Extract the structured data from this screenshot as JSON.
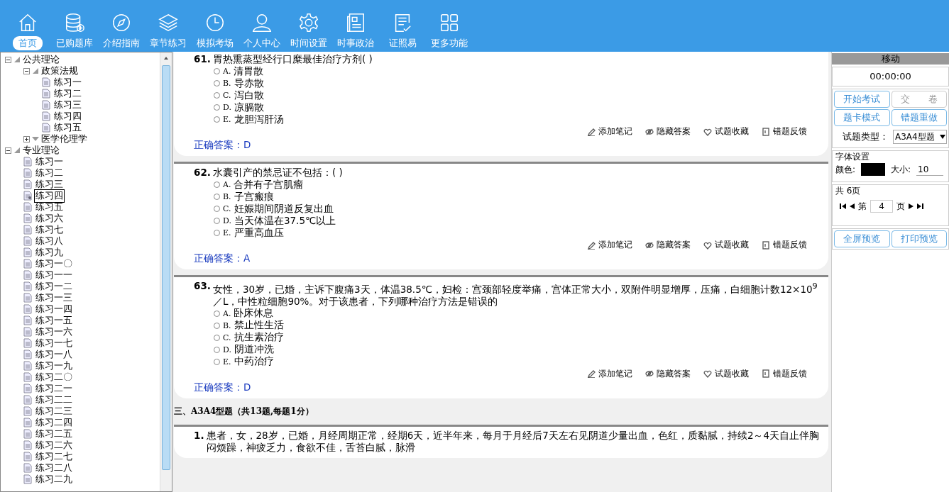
{
  "nav": [
    {
      "label": "首页",
      "selected": true
    },
    {
      "label": "已购题库",
      "selected": false
    },
    {
      "label": "介绍指南",
      "selected": false
    },
    {
      "label": "章节练习",
      "selected": false
    },
    {
      "label": "模拟考场",
      "selected": false
    },
    {
      "label": "个人中心",
      "selected": false
    },
    {
      "label": "时间设置",
      "selected": false
    },
    {
      "label": "时事政治",
      "selected": false
    },
    {
      "label": "证照易",
      "selected": false
    },
    {
      "label": "更多功能",
      "selected": false
    }
  ],
  "tree": [
    {
      "label": "公共理论",
      "expanded": true,
      "children": [
        {
          "label": "政策法规",
          "expanded": true,
          "children": [
            {
              "label": "练习一",
              "selected": false
            },
            {
              "label": "练习二",
              "selected": false
            },
            {
              "label": "练习三",
              "selected": false
            },
            {
              "label": "练习四",
              "selected": false
            },
            {
              "label": "练习五",
              "selected": false
            }
          ]
        },
        {
          "label": "医学伦理学",
          "expanded": false
        }
      ]
    },
    {
      "label": "专业理论",
      "expanded": true,
      "children": [
        {
          "label": "练习一",
          "selected": false
        },
        {
          "label": "练习二",
          "selected": false
        },
        {
          "label": "练习三",
          "selected": false
        },
        {
          "label": "练习四",
          "selected": true
        },
        {
          "label": "练习五",
          "selected": false
        },
        {
          "label": "练习六",
          "selected": false
        },
        {
          "label": "练习七",
          "selected": false
        },
        {
          "label": "练习八",
          "selected": false
        },
        {
          "label": "练习九",
          "selected": false
        },
        {
          "label": "练习一〇",
          "selected": false
        },
        {
          "label": "练习一一",
          "selected": false
        },
        {
          "label": "练习一二",
          "selected": false
        },
        {
          "label": "练习一三",
          "selected": false
        },
        {
          "label": "练习一四",
          "selected": false
        },
        {
          "label": "练习一五",
          "selected": false
        },
        {
          "label": "练习一六",
          "selected": false
        },
        {
          "label": "练习一七",
          "selected": false
        },
        {
          "label": "练习一八",
          "selected": false
        },
        {
          "label": "练习一九",
          "selected": false
        },
        {
          "label": "练习二〇",
          "selected": false
        },
        {
          "label": "练习二一",
          "selected": false
        },
        {
          "label": "练习二二",
          "selected": false
        },
        {
          "label": "练习二三",
          "selected": false
        },
        {
          "label": "练习二四",
          "selected": false
        },
        {
          "label": "练习二五",
          "selected": false
        },
        {
          "label": "练习二六",
          "selected": false
        },
        {
          "label": "练习二七",
          "selected": false
        },
        {
          "label": "练习二八",
          "selected": false
        },
        {
          "label": "练习二九",
          "selected": false
        }
      ]
    }
  ],
  "questions": [
    {
      "number": "61.",
      "text": "胃热熏蒸型经行口糜最佳治疗方剂( )",
      "options": [
        {
          "letter": "A.",
          "text": "清胃散",
          "selected": false
        },
        {
          "letter": "B.",
          "text": "导赤散",
          "selected": false
        },
        {
          "letter": "C.",
          "text": "泻白散",
          "selected": false
        },
        {
          "letter": "D.",
          "text": "凉膈散",
          "selected": false
        },
        {
          "letter": "E.",
          "text": "龙胆泻肝汤",
          "selected": false
        }
      ],
      "actions": [
        "添加笔记",
        "隐藏答案",
        "试题收藏",
        "错题反馈"
      ],
      "answer_label": "正确答案：",
      "answer": "D"
    },
    {
      "number": "62.",
      "text": "水囊引产的禁忌证不包括：( )",
      "options": [
        {
          "letter": "A.",
          "text": "合并有子宫肌瘤",
          "selected": false
        },
        {
          "letter": "B.",
          "text": "子宫瘢痕",
          "selected": false
        },
        {
          "letter": "C.",
          "text": "妊娠期间阴道反复出血",
          "selected": false
        },
        {
          "letter": "D.",
          "text": "当天体温在37.5℃以上",
          "selected": false
        },
        {
          "letter": "E.",
          "text": "严重高血压",
          "selected": false
        }
      ],
      "actions": [
        "添加笔记",
        "隐藏答案",
        "试题收藏",
        "错题反馈"
      ],
      "answer_label": "正确答案：",
      "answer": "A"
    },
    {
      "number": "63.",
      "text": "女性，30岁，已婚，主诉下腹痛3天，体温38.5℃，妇检：宫颈部轻度举痛，宫体正常大小，双附件明显增厚，压痛，白细胞计数12×10$^{9}$／L，中性粒细胞90%。对于该患者，下列哪种治疗方法是错误的",
      "options": [
        {
          "letter": "A.",
          "text": "卧床休息",
          "selected": false
        },
        {
          "letter": "B.",
          "text": "禁止性生活",
          "selected": false
        },
        {
          "letter": "C.",
          "text": "抗生素治疗",
          "selected": false
        },
        {
          "letter": "D.",
          "text": "阴道冲洗",
          "selected": false
        },
        {
          "letter": "E.",
          "text": "中药治疗",
          "selected": false
        }
      ],
      "actions": [
        "添加笔记",
        "隐藏答案",
        "试题收藏",
        "错题反馈"
      ],
      "answer_label": "正确答案：",
      "answer": "D"
    }
  ],
  "section_heading": "三、A3A4型题（共13题,每题1分）",
  "case": {
    "number": "1.",
    "text": "患者，女，28岁，已婚，月经周期正常，经期6天，近半年来，每月于月经后7天左右见阴道少量出血，色红，质黏腻，持续2～4天自止伴胸闷烦躁，神疲乏力，食欲不佳，舌苔白腻，脉滑"
  },
  "panel": {
    "title": "移动",
    "timer": "00:00:00",
    "buttons": [
      {
        "label": "开始考试",
        "disabled": false
      },
      {
        "label": "交　　卷",
        "disabled": true
      },
      {
        "label": "题卡模式",
        "disabled": false
      },
      {
        "label": "错题重做",
        "disabled": false
      }
    ],
    "type_label": "试题类型：",
    "type_value": "A3A4型题",
    "font_group": "字体设置",
    "color_label": "颜色:",
    "size_label": "大小:",
    "size_value": "10",
    "pages_group": "共 6页",
    "page_prefix": "第",
    "page_value": "4",
    "page_suffix": "页",
    "bottom_buttons": [
      "全屏预览",
      "打印预览"
    ]
  }
}
